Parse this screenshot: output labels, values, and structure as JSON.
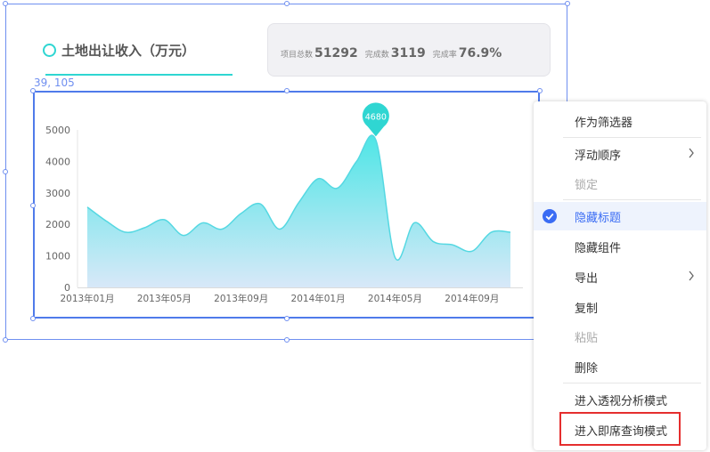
{
  "widget": {
    "title": "土地出让收入（万元）",
    "stats": [
      {
        "label": "项目总数",
        "value": "51292"
      },
      {
        "label": "完成数",
        "value": "3119"
      },
      {
        "label": "完成率",
        "value": "76.9%"
      }
    ],
    "coord_readout": "39, 105"
  },
  "colors": {
    "accent": "#2fd6d2",
    "selection": "#4f7bea",
    "menu_active": "#3a6cf4",
    "highlight": "#e52e2e"
  },
  "chart_data": {
    "type": "area",
    "x": [
      0,
      1,
      2,
      3,
      4,
      5,
      6,
      7,
      8,
      9,
      10,
      11,
      12,
      13,
      14,
      15,
      16,
      17,
      18,
      19,
      20,
      21,
      22
    ],
    "values": [
      2550,
      2100,
      1750,
      1900,
      2150,
      1650,
      2050,
      1850,
      2350,
      2650,
      1850,
      2700,
      3450,
      3150,
      4000,
      4680,
      950,
      2050,
      1450,
      1350,
      1150,
      1750,
      1750
    ],
    "peak_label": "4680",
    "x_tick_labels": [
      "2013年01月",
      "2013年05月",
      "2013年09月",
      "2014年01月",
      "2014年05月",
      "2014年09月"
    ],
    "x_tick_positions": [
      0,
      4,
      8,
      12,
      16,
      20
    ],
    "y_ticks": [
      0,
      1000,
      2000,
      3000,
      4000,
      5000
    ],
    "ylim": [
      0,
      5000
    ],
    "gradient": [
      "#4ee6e6",
      "#d8e8f8"
    ],
    "grid": false,
    "xlabel": "",
    "ylabel": ""
  },
  "context_menu": {
    "items": [
      {
        "label": "作为筛选器"
      },
      {
        "label": "浮动顺序",
        "submenu": true
      },
      {
        "label": "锁定",
        "disabled": true
      },
      {
        "label": "隐藏标题",
        "checked": true
      },
      {
        "label": "隐藏组件"
      },
      {
        "label": "导出",
        "submenu": true
      },
      {
        "label": "复制"
      },
      {
        "label": "粘贴",
        "disabled": true
      },
      {
        "label": "删除"
      },
      {
        "label": "进入透视分析模式"
      },
      {
        "label": "进入即席查询模式",
        "highlighted": true
      }
    ]
  }
}
